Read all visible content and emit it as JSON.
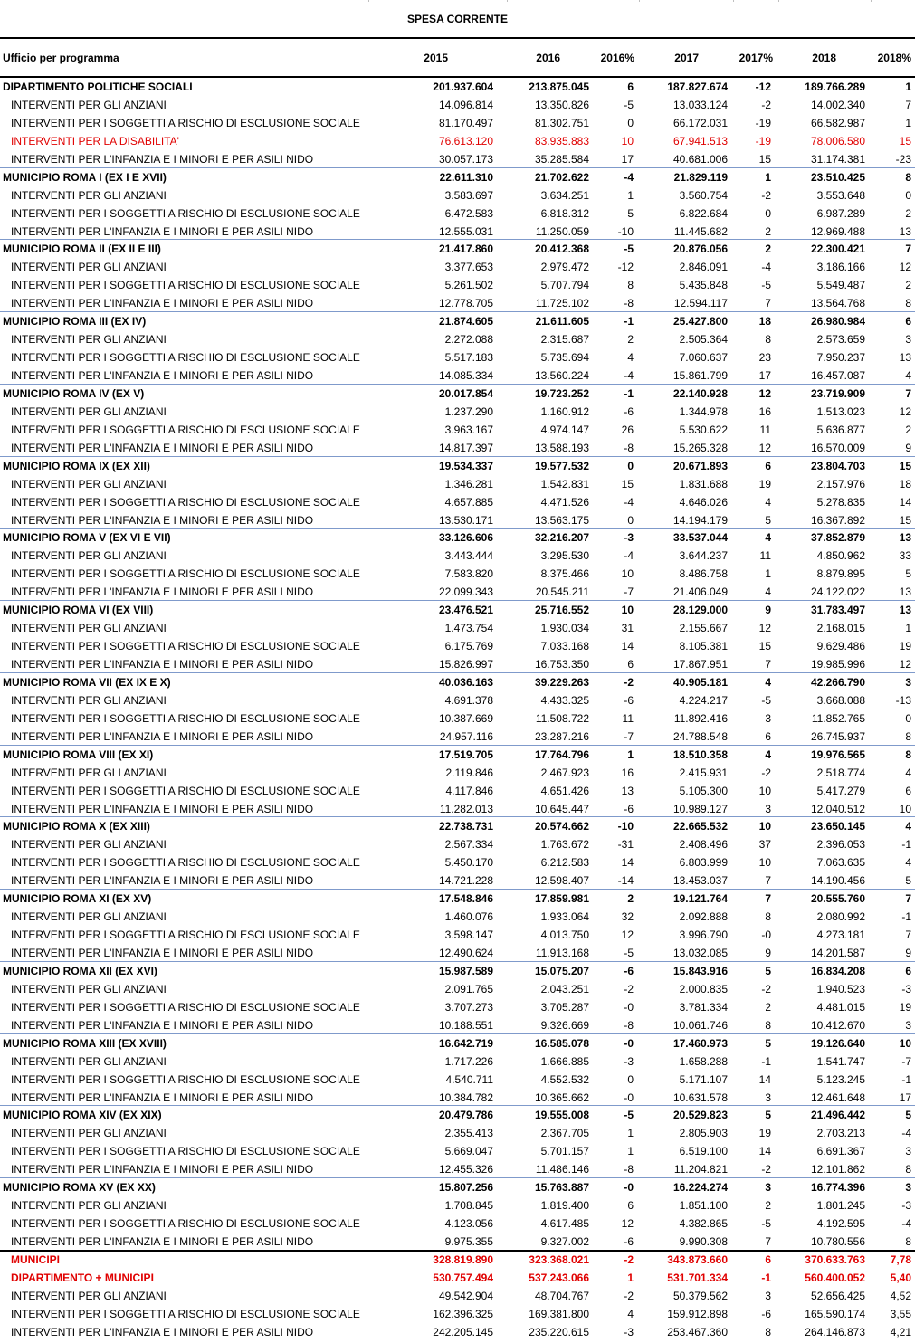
{
  "title": "SPESA CORRENTE",
  "headers": [
    "Ufficio per programma",
    "2015",
    "2016",
    "2016%",
    "2017",
    "2017%",
    "2018",
    "2018%"
  ],
  "colors": {
    "red_text": "#e00000",
    "separator": "#7f9acb",
    "flag": "#1a8a1a"
  },
  "rows": [
    {
      "label": "DIPARTIMENTO POLITICHE SOCIALI",
      "v2015": "201.937.604",
      "v2016": "213.875.045",
      "p2016": "6",
      "v2017": "187.827.674",
      "p2017": "-12",
      "v2018": "189.766.289",
      "p2018": "1",
      "style": "bold"
    },
    {
      "label": "INTERVENTI PER GLI ANZIANI",
      "v2015": "14.096.814",
      "v2016": "13.350.826",
      "p2016": "-5",
      "v2017": "13.033.124",
      "p2017": "-2",
      "v2018": "14.002.340",
      "p2018": "7",
      "style": "sub"
    },
    {
      "label": "INTERVENTI PER I SOGGETTI A RISCHIO DI ESCLUSIONE SOCIALE",
      "v2015": "81.170.497",
      "v2016": "81.302.751",
      "p2016": "0",
      "v2017": "66.172.031",
      "p2017": "-19",
      "v2018": "66.582.987",
      "p2018": "1",
      "style": "sub"
    },
    {
      "label": "INTERVENTI PER LA DISABILITA'",
      "v2015": "76.613.120",
      "v2016": "83.935.883",
      "p2016": "10",
      "v2017": "67.941.513",
      "p2017": "-19",
      "v2018": "78.006.580",
      "p2018": "15",
      "style": "sub-red"
    },
    {
      "label": "INTERVENTI PER L'INFANZIA E I MINORI E PER ASILI NIDO",
      "v2015": "30.057.173",
      "v2016": "35.285.584",
      "p2016": "17",
      "v2017": "40.681.006",
      "p2017": "15",
      "v2018": "31.174.381",
      "p2018": "-23",
      "style": "sub"
    },
    {
      "label": "MUNICIPIO ROMA I (EX I E XVII)",
      "v2015": "22.611.310",
      "v2016": "21.702.622",
      "p2016": "-4",
      "v2017": "21.829.119",
      "p2017": "1",
      "v2018": "23.510.425",
      "p2018": "8",
      "style": "bold"
    },
    {
      "label": "INTERVENTI PER GLI ANZIANI",
      "v2015": "3.583.697",
      "v2016": "3.634.251",
      "p2016": "1",
      "v2017": "3.560.754",
      "p2017": "-2",
      "v2018": "3.553.648",
      "p2018": "0",
      "style": "sub"
    },
    {
      "label": "INTERVENTI PER I SOGGETTI A RISCHIO DI ESCLUSIONE SOCIALE",
      "v2015": "6.472.583",
      "v2016": "6.818.312",
      "p2016": "5",
      "v2017": "6.822.684",
      "p2017": "0",
      "v2018": "6.987.289",
      "p2018": "2",
      "style": "sub"
    },
    {
      "label": "INTERVENTI PER L'INFANZIA E I MINORI E PER ASILI NIDO",
      "v2015": "12.555.031",
      "v2016": "11.250.059",
      "p2016": "-10",
      "v2017": "11.445.682",
      "p2017": "2",
      "v2018": "12.969.488",
      "p2018": "13",
      "style": "sub"
    },
    {
      "label": "MUNICIPIO ROMA II (EX II E III)",
      "v2015": "21.417.860",
      "v2016": "20.412.368",
      "p2016": "-5",
      "v2017": "20.876.056",
      "p2017": "2",
      "v2018": "22.300.421",
      "p2018": "7",
      "style": "bold"
    },
    {
      "label": "INTERVENTI PER GLI ANZIANI",
      "v2015": "3.377.653",
      "v2016": "2.979.472",
      "p2016": "-12",
      "v2017": "2.846.091",
      "p2017": "-4",
      "v2018": "3.186.166",
      "p2018": "12",
      "style": "sub"
    },
    {
      "label": "INTERVENTI PER I SOGGETTI A RISCHIO DI ESCLUSIONE SOCIALE",
      "v2015": "5.261.502",
      "v2016": "5.707.794",
      "p2016": "8",
      "v2017": "5.435.848",
      "p2017": "-5",
      "v2018": "5.549.487",
      "p2018": "2",
      "style": "sub"
    },
    {
      "label": "INTERVENTI PER L'INFANZIA E I MINORI E PER ASILI NIDO",
      "v2015": "12.778.705",
      "v2016": "11.725.102",
      "p2016": "-8",
      "v2017": "12.594.117",
      "p2017": "7",
      "v2018": "13.564.768",
      "p2018": "8",
      "style": "sub"
    },
    {
      "label": "MUNICIPIO ROMA III (EX IV)",
      "v2015": "21.874.605",
      "v2016": "21.611.605",
      "p2016": "-1",
      "v2017": "25.427.800",
      "p2017": "18",
      "v2018": "26.980.984",
      "p2018": "6",
      "style": "bold"
    },
    {
      "label": "INTERVENTI PER GLI ANZIANI",
      "v2015": "2.272.088",
      "v2016": "2.315.687",
      "p2016": "2",
      "v2017": "2.505.364",
      "p2017": "8",
      "v2018": "2.573.659",
      "p2018": "3",
      "style": "sub"
    },
    {
      "label": "INTERVENTI PER I SOGGETTI A RISCHIO DI ESCLUSIONE SOCIALE",
      "v2015": "5.517.183",
      "v2016": "5.735.694",
      "p2016": "4",
      "v2017": "7.060.637",
      "p2017": "23",
      "v2018": "7.950.237",
      "p2018": "13",
      "style": "sub"
    },
    {
      "label": "INTERVENTI PER L'INFANZIA E I MINORI E PER ASILI NIDO",
      "v2015": "14.085.334",
      "v2016": "13.560.224",
      "p2016": "-4",
      "v2017": "15.861.799",
      "p2017": "17",
      "v2018": "16.457.087",
      "p2018": "4",
      "style": "sub"
    },
    {
      "label": "MUNICIPIO ROMA IV (EX V)",
      "v2015": "20.017.854",
      "v2016": "19.723.252",
      "p2016": "-1",
      "v2017": "22.140.928",
      "p2017": "12",
      "v2018": "23.719.909",
      "p2018": "7",
      "style": "bold"
    },
    {
      "label": "INTERVENTI PER GLI ANZIANI",
      "v2015": "1.237.290",
      "v2016": "1.160.912",
      "p2016": "-6",
      "v2017": "1.344.978",
      "p2017": "16",
      "v2018": "1.513.023",
      "p2018": "12",
      "style": "sub"
    },
    {
      "label": "INTERVENTI PER I SOGGETTI A RISCHIO DI ESCLUSIONE SOCIALE",
      "v2015": "3.963.167",
      "v2016": "4.974.147",
      "p2016": "26",
      "v2017": "5.530.622",
      "p2017": "11",
      "v2018": "5.636.877",
      "p2018": "2",
      "style": "sub"
    },
    {
      "label": "INTERVENTI PER L'INFANZIA E I MINORI E PER ASILI NIDO",
      "v2015": "14.817.397",
      "v2016": "13.588.193",
      "p2016": "-8",
      "v2017": "15.265.328",
      "p2017": "12",
      "v2018": "16.570.009",
      "p2018": "9",
      "style": "sub"
    },
    {
      "label": "MUNICIPIO ROMA IX (EX XII)",
      "v2015": "19.534.337",
      "v2016": "19.577.532",
      "p2016": "0",
      "v2017": "20.671.893",
      "p2017": "6",
      "v2018": "23.804.703",
      "p2018": "15",
      "style": "bold"
    },
    {
      "label": "INTERVENTI PER GLI ANZIANI",
      "v2015": "1.346.281",
      "v2016": "1.542.831",
      "p2016": "15",
      "v2017": "1.831.688",
      "p2017": "19",
      "v2018": "2.157.976",
      "p2018": "18",
      "style": "sub"
    },
    {
      "label": "INTERVENTI PER I SOGGETTI A RISCHIO DI ESCLUSIONE SOCIALE",
      "v2015": "4.657.885",
      "v2016": "4.471.526",
      "p2016": "-4",
      "v2017": "4.646.026",
      "p2017": "4",
      "v2018": "5.278.835",
      "p2018": "14",
      "style": "sub"
    },
    {
      "label": "INTERVENTI PER L'INFANZIA E I MINORI E PER ASILI NIDO",
      "v2015": "13.530.171",
      "v2016": "13.563.175",
      "p2016": "0",
      "v2017": "14.194.179",
      "p2017": "5",
      "v2018": "16.367.892",
      "p2018": "15",
      "style": "sub"
    },
    {
      "label": "MUNICIPIO ROMA V (EX VI E VII)",
      "v2015": "33.126.606",
      "v2016": "32.216.207",
      "p2016": "-3",
      "v2017": "33.537.044",
      "p2017": "4",
      "v2018": "37.852.879",
      "p2018": "13",
      "style": "bold"
    },
    {
      "label": "INTERVENTI PER GLI ANZIANI",
      "v2015": "3.443.444",
      "v2016": "3.295.530",
      "p2016": "-4",
      "v2017": "3.644.237",
      "p2017": "11",
      "v2018": "4.850.962",
      "p2018": "33",
      "style": "sub"
    },
    {
      "label": "INTERVENTI PER I SOGGETTI A RISCHIO DI ESCLUSIONE SOCIALE",
      "v2015": "7.583.820",
      "v2016": "8.375.466",
      "p2016": "10",
      "v2017": "8.486.758",
      "p2017": "1",
      "v2018": "8.879.895",
      "p2018": "5",
      "style": "sub"
    },
    {
      "label": "INTERVENTI PER L'INFANZIA E I MINORI E PER ASILI NIDO",
      "v2015": "22.099.343",
      "v2016": "20.545.211",
      "p2016": "-7",
      "v2017": "21.406.049",
      "p2017": "4",
      "v2018": "24.122.022",
      "p2018": "13",
      "style": "sub"
    },
    {
      "label": "MUNICIPIO ROMA VI (EX VIII)",
      "v2015": "23.476.521",
      "v2016": "25.716.552",
      "p2016": "10",
      "v2017": "28.129.000",
      "p2017": "9",
      "v2018": "31.783.497",
      "p2018": "13",
      "style": "bold"
    },
    {
      "label": "INTERVENTI PER GLI ANZIANI",
      "v2015": "1.473.754",
      "v2016": "1.930.034",
      "p2016": "31",
      "v2017": "2.155.667",
      "p2017": "12",
      "v2018": "2.168.015",
      "p2018": "1",
      "style": "sub"
    },
    {
      "label": "INTERVENTI PER I SOGGETTI A RISCHIO DI ESCLUSIONE SOCIALE",
      "v2015": "6.175.769",
      "v2016": "7.033.168",
      "p2016": "14",
      "v2017": "8.105.381",
      "p2017": "15",
      "v2018": "9.629.486",
      "p2018": "19",
      "style": "sub"
    },
    {
      "label": "INTERVENTI PER L'INFANZIA E I MINORI E PER ASILI NIDO",
      "v2015": "15.826.997",
      "v2016": "16.753.350",
      "p2016": "6",
      "v2017": "17.867.951",
      "p2017": "7",
      "v2018": "19.985.996",
      "p2018": "12",
      "style": "sub"
    },
    {
      "label": "MUNICIPIO ROMA VII (EX IX E X)",
      "v2015": "40.036.163",
      "v2016": "39.229.263",
      "p2016": "-2",
      "v2017": "40.905.181",
      "p2017": "4",
      "v2018": "42.266.790",
      "p2018": "3",
      "style": "bold"
    },
    {
      "label": "INTERVENTI PER GLI ANZIANI",
      "v2015": "4.691.378",
      "v2016": "4.433.325",
      "p2016": "-6",
      "v2017": "4.224.217",
      "p2017": "-5",
      "v2018": "3.668.088",
      "p2018": "-13",
      "style": "sub"
    },
    {
      "label": "INTERVENTI PER I SOGGETTI A RISCHIO DI ESCLUSIONE SOCIALE",
      "v2015": "10.387.669",
      "v2016": "11.508.722",
      "p2016": "11",
      "v2017": "11.892.416",
      "p2017": "3",
      "v2018": "11.852.765",
      "p2018": "0",
      "style": "sub"
    },
    {
      "label": "INTERVENTI PER L'INFANZIA E I MINORI E PER ASILI NIDO",
      "v2015": "24.957.116",
      "v2016": "23.287.216",
      "p2016": "-7",
      "v2017": "24.788.548",
      "p2017": "6",
      "v2018": "26.745.937",
      "p2018": "8",
      "style": "sub"
    },
    {
      "label": "MUNICIPIO ROMA VIII (EX XI)",
      "v2015": "17.519.705",
      "v2016": "17.764.796",
      "p2016": "1",
      "v2017": "18.510.358",
      "p2017": "4",
      "v2018": "19.976.565",
      "p2018": "8",
      "style": "bold"
    },
    {
      "label": "INTERVENTI PER GLI ANZIANI",
      "v2015": "2.119.846",
      "v2016": "2.467.923",
      "p2016": "16",
      "v2017": "2.415.931",
      "p2017": "-2",
      "v2018": "2.518.774",
      "p2018": "4",
      "style": "sub"
    },
    {
      "label": "INTERVENTI PER I SOGGETTI A RISCHIO DI ESCLUSIONE SOCIALE",
      "v2015": "4.117.846",
      "v2016": "4.651.426",
      "p2016": "13",
      "v2017": "5.105.300",
      "p2017": "10",
      "v2018": "5.417.279",
      "p2018": "6",
      "style": "sub"
    },
    {
      "label": "INTERVENTI PER L'INFANZIA E I MINORI E PER ASILI NIDO",
      "v2015": "11.282.013",
      "v2016": "10.645.447",
      "p2016": "-6",
      "v2017": "10.989.127",
      "p2017": "3",
      "v2018": "12.040.512",
      "p2018": "10",
      "style": "sub"
    },
    {
      "label": "MUNICIPIO ROMA X (EX XIII)",
      "v2015": "22.738.731",
      "v2016": "20.574.662",
      "p2016": "-10",
      "v2017": "22.665.532",
      "p2017": "10",
      "v2018": "23.650.145",
      "p2018": "4",
      "style": "bold"
    },
    {
      "label": "INTERVENTI PER GLI ANZIANI",
      "v2015": "2.567.334",
      "v2016": "1.763.672",
      "p2016": "-31",
      "v2017": "2.408.496",
      "p2017": "37",
      "v2018": "2.396.053",
      "p2018": "-1",
      "style": "sub"
    },
    {
      "label": "INTERVENTI PER I SOGGETTI A RISCHIO DI ESCLUSIONE SOCIALE",
      "v2015": "5.450.170",
      "v2016": "6.212.583",
      "p2016": "14",
      "v2017": "6.803.999",
      "p2017": "10",
      "v2018": "7.063.635",
      "p2018": "4",
      "style": "sub"
    },
    {
      "label": "INTERVENTI PER L'INFANZIA E I MINORI E PER ASILI NIDO",
      "v2015": "14.721.228",
      "v2016": "12.598.407",
      "p2016": "-14",
      "v2017": "13.453.037",
      "p2017": "7",
      "v2018": "14.190.456",
      "p2018": "5",
      "style": "sub"
    },
    {
      "label": "MUNICIPIO ROMA XI (EX XV)",
      "v2015": "17.548.846",
      "v2016": "17.859.981",
      "p2016": "2",
      "v2017": "19.121.764",
      "p2017": "7",
      "v2018": "20.555.760",
      "p2018": "7",
      "style": "bold"
    },
    {
      "label": "INTERVENTI PER GLI ANZIANI",
      "v2015": "1.460.076",
      "v2016": "1.933.064",
      "p2016": "32",
      "v2017": "2.092.888",
      "p2017": "8",
      "v2018": "2.080.992",
      "p2018": "-1",
      "style": "sub"
    },
    {
      "label": "INTERVENTI PER I SOGGETTI A RISCHIO DI ESCLUSIONE SOCIALE",
      "v2015": "3.598.147",
      "v2016": "4.013.750",
      "p2016": "12",
      "v2017": "3.996.790",
      "p2017": "-0",
      "v2018": "4.273.181",
      "p2018": "7",
      "style": "sub"
    },
    {
      "label": "INTERVENTI PER L'INFANZIA E I MINORI E PER ASILI NIDO",
      "v2015": "12.490.624",
      "v2016": "11.913.168",
      "p2016": "-5",
      "v2017": "13.032.085",
      "p2017": "9",
      "v2018": "14.201.587",
      "p2018": "9",
      "style": "sub"
    },
    {
      "label": "MUNICIPIO ROMA XII (EX XVI)",
      "v2015": "15.987.589",
      "v2016": "15.075.207",
      "p2016": "-6",
      "v2017": "15.843.916",
      "p2017": "5",
      "v2018": "16.834.208",
      "p2018": "6",
      "style": "bold"
    },
    {
      "label": "INTERVENTI PER GLI ANZIANI",
      "v2015": "2.091.765",
      "v2016": "2.043.251",
      "p2016": "-2",
      "v2017": "2.000.835",
      "p2017": "-2",
      "v2018": "1.940.523",
      "p2018": "-3",
      "style": "sub"
    },
    {
      "label": "INTERVENTI PER I SOGGETTI A RISCHIO DI ESCLUSIONE SOCIALE",
      "v2015": "3.707.273",
      "v2016": "3.705.287",
      "p2016": "-0",
      "v2017": "3.781.334",
      "p2017": "2",
      "v2018": "4.481.015",
      "p2018": "19",
      "style": "sub"
    },
    {
      "label": "INTERVENTI PER L'INFANZIA E I MINORI E PER ASILI NIDO",
      "v2015": "10.188.551",
      "v2016": "9.326.669",
      "p2016": "-8",
      "v2017": "10.061.746",
      "p2017": "8",
      "v2018": "10.412.670",
      "p2018": "3",
      "style": "sub"
    },
    {
      "label": "MUNICIPIO ROMA XIII (EX XVIII)",
      "v2015": "16.642.719",
      "v2016": "16.585.078",
      "p2016": "-0",
      "v2017": "17.460.973",
      "p2017": "5",
      "v2018": "19.126.640",
      "p2018": "10",
      "style": "bold"
    },
    {
      "label": "INTERVENTI PER GLI ANZIANI",
      "v2015": "1.717.226",
      "v2016": "1.666.885",
      "p2016": "-3",
      "v2017": "1.658.288",
      "p2017": "-1",
      "v2018": "1.541.747",
      "p2018": "-7",
      "style": "sub"
    },
    {
      "label": "INTERVENTI PER I SOGGETTI A RISCHIO DI ESCLUSIONE SOCIALE",
      "v2015": "4.540.711",
      "v2016": "4.552.532",
      "p2016": "0",
      "v2017": "5.171.107",
      "p2017": "14",
      "v2018": "5.123.245",
      "p2018": "-1",
      "style": "sub"
    },
    {
      "label": "INTERVENTI PER L'INFANZIA E I MINORI E PER ASILI NIDO",
      "v2015": "10.384.782",
      "v2016": "10.365.662",
      "p2016": "-0",
      "v2017": "10.631.578",
      "p2017": "3",
      "v2018": "12.461.648",
      "p2018": "17",
      "style": "sub"
    },
    {
      "label": "MUNICIPIO ROMA XIV (EX XIX)",
      "v2015": "20.479.786",
      "v2016": "19.555.008",
      "p2016": "-5",
      "v2017": "20.529.823",
      "p2017": "5",
      "v2018": "21.496.442",
      "p2018": "5",
      "style": "bold"
    },
    {
      "label": "INTERVENTI PER GLI ANZIANI",
      "v2015": "2.355.413",
      "v2016": "2.367.705",
      "p2016": "1",
      "v2017": "2.805.903",
      "p2017": "19",
      "v2018": "2.703.213",
      "p2018": "-4",
      "style": "sub"
    },
    {
      "label": "INTERVENTI PER I SOGGETTI A RISCHIO DI ESCLUSIONE SOCIALE",
      "v2015": "5.669.047",
      "v2016": "5.701.157",
      "p2016": "1",
      "v2017": "6.519.100",
      "p2017": "14",
      "v2018": "6.691.367",
      "p2018": "3",
      "style": "sub"
    },
    {
      "label": "INTERVENTI PER L'INFANZIA E I MINORI E PER ASILI NIDO",
      "v2015": "12.455.326",
      "v2016": "11.486.146",
      "p2016": "-8",
      "v2017": "11.204.821",
      "p2017": "-2",
      "v2018": "12.101.862",
      "p2018": "8",
      "style": "sub"
    },
    {
      "label": "MUNICIPIO ROMA XV (EX XX)",
      "v2015": "15.807.256",
      "v2016": "15.763.887",
      "p2016": "-0",
      "v2017": "16.224.274",
      "p2017": "3",
      "v2018": "16.774.396",
      "p2018": "3",
      "style": "bold"
    },
    {
      "label": "INTERVENTI PER GLI ANZIANI",
      "v2015": "1.708.845",
      "v2016": "1.819.400",
      "p2016": "6",
      "v2017": "1.851.100",
      "p2017": "2",
      "v2018": "1.801.245",
      "p2018": "-3",
      "style": "sub"
    },
    {
      "label": "INTERVENTI PER I SOGGETTI A RISCHIO DI ESCLUSIONE SOCIALE",
      "v2015": "4.123.056",
      "v2016": "4.617.485",
      "p2016": "12",
      "v2017": "4.382.865",
      "p2017": "-5",
      "v2018": "4.192.595",
      "p2018": "-4",
      "style": "sub"
    },
    {
      "label": "INTERVENTI PER L'INFANZIA E I MINORI E PER ASILI NIDO",
      "v2015": "9.975.355",
      "v2016": "9.327.002",
      "p2016": "-6",
      "v2017": "9.990.308",
      "p2017": "7",
      "v2018": "10.780.556",
      "p2018": "8",
      "style": "sub"
    },
    {
      "label": "MUNICIPI",
      "v2015": "328.819.890",
      "v2016": "323.368.021",
      "p2016": "-2",
      "v2017": "343.873.660",
      "p2017": "6",
      "v2018": "370.633.763",
      "p2018": "7,78",
      "style": "total-red"
    },
    {
      "label": "DIPARTIMENTO + MUNICIPI",
      "v2015": "530.757.494",
      "v2016": "537.243.066",
      "p2016": "1",
      "v2017": "531.701.334",
      "p2017": "-1",
      "v2018": "560.400.052",
      "p2018": "5,40",
      "style": "total-red"
    },
    {
      "label": "INTERVENTI PER GLI ANZIANI",
      "v2015": "49.542.904",
      "v2016": "48.704.767",
      "p2016": "-2",
      "v2017": "50.379.562",
      "p2017": "3",
      "v2018": "52.656.425",
      "p2018": "4,52",
      "style": "total-sub"
    },
    {
      "label": "INTERVENTI PER I SOGGETTI A RISCHIO DI ESCLUSIONE SOCIALE",
      "v2015": "162.396.325",
      "v2016": "169.381.800",
      "p2016": "4",
      "v2017": "159.912.898",
      "p2017": "-6",
      "v2018": "165.590.174",
      "p2018": "3,55",
      "style": "total-sub"
    },
    {
      "label": "INTERVENTI PER L'INFANZIA E I MINORI E PER ASILI NIDO",
      "v2015": "242.205.145",
      "v2016": "235.220.615",
      "p2016": "-3",
      "v2017": "253.467.360",
      "p2017": "8",
      "v2018": "264.146.873",
      "p2018": "4,21",
      "style": "total-sub"
    }
  ]
}
